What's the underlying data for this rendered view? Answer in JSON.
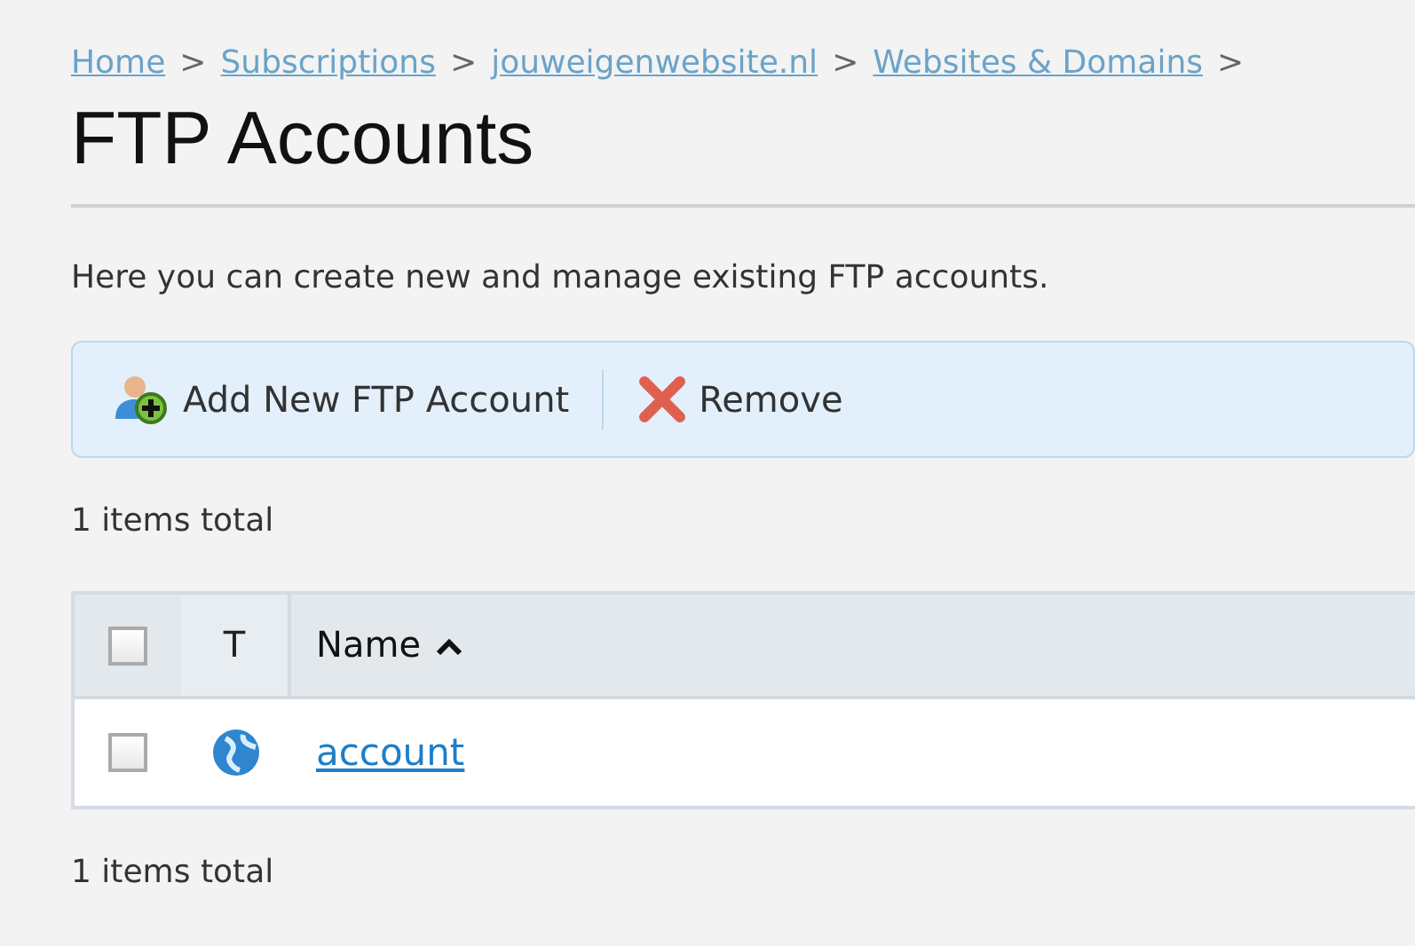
{
  "breadcrumb": [
    "Home",
    "Subscriptions",
    "jouweigenwebsite.nl",
    "Websites & Domains"
  ],
  "breadcrumb_separator": ">",
  "title": "FTP Accounts",
  "description": "Here you can create new and manage existing FTP accounts.",
  "toolbar": [
    {
      "kind": "add",
      "label": "Add New FTP Account"
    },
    {
      "kind": "remove",
      "label": "Remove"
    }
  ],
  "count_top": "1 items total",
  "table": {
    "select_all_checked": false,
    "columns": [
      {
        "label": "T",
        "sorted": false
      },
      {
        "label": "Name",
        "sorted": true
      }
    ],
    "rows": [
      {
        "checked": false,
        "kind": "web",
        "name": "account"
      }
    ]
  },
  "count_bottom": "1 items total"
}
